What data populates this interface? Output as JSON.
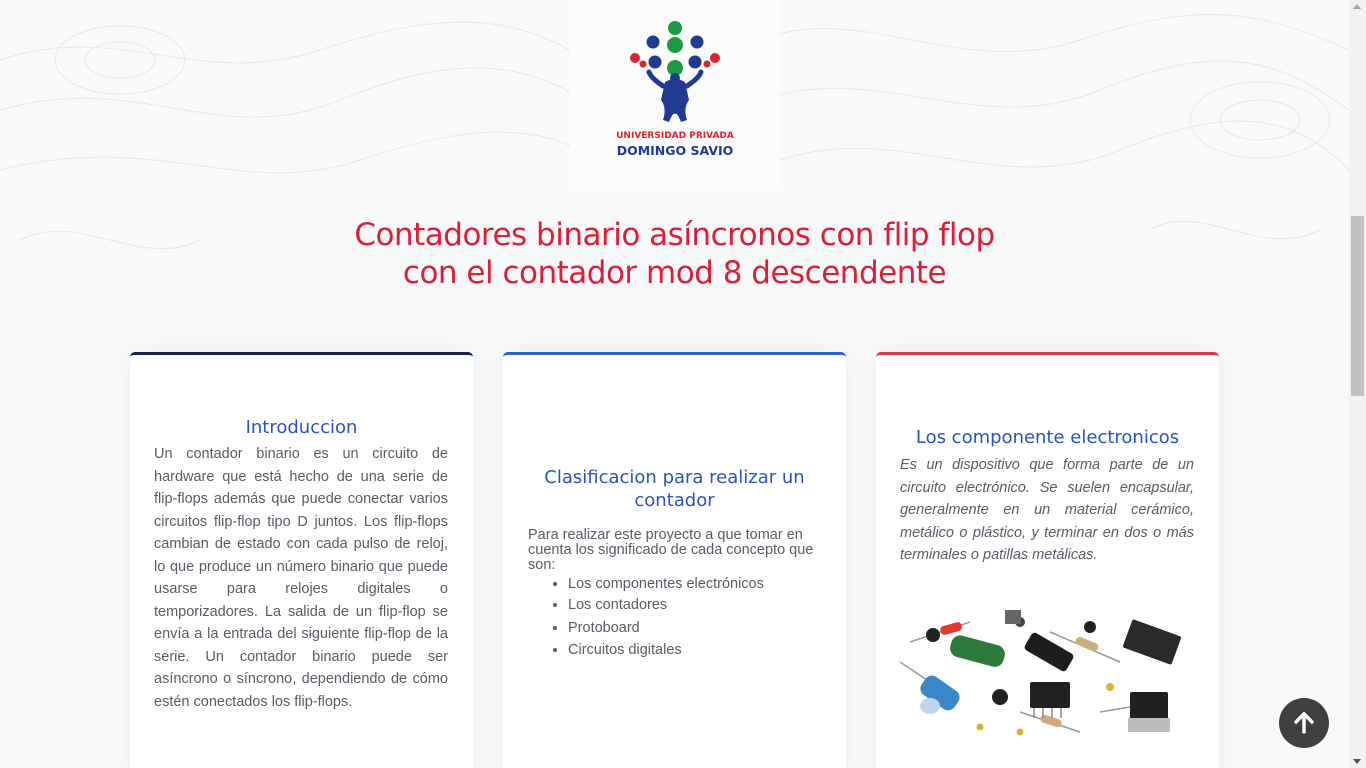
{
  "logo": {
    "line1": "UNIVERSIDAD PRIVADA",
    "line2": "DOMINGO SAVIO"
  },
  "page_title": {
    "line1": "Contadores binario asíncronos con flip flop",
    "line2": "con el contador mod 8 descendente"
  },
  "cards": [
    {
      "title": "Introduccion",
      "text": "Un contador binario es un circuito de hardware que está hecho de una serie de flip-flops además que puede conectar varios circuitos flip-flop tipo D juntos. Los flip-flops cambian de estado con cada pulso de reloj, lo que produce un número binario que puede usarse para relojes digitales o temporizadores. La salida de un flip-flop se envía a la entrada del siguiente flip-flop de la serie. Un contador binario puede ser asíncrono o síncrono, dependiendo de cómo estén conectados los flip-flops."
    },
    {
      "title": "Clasificacion para realizar un contador",
      "intro": "Para realizar este proyecto a que tomar en cuenta los significado de cada concepto que son:",
      "items": [
        "Los componentes electrónicos",
        "Los contadores",
        "Protoboard",
        "Circuitos digitales"
      ]
    },
    {
      "title": "Los componente electronicos",
      "text": "Es un dispositivo que forma parte de un circuito electrónico. Se suelen encapsular, generalmente en un material cerámico, metálico o plástico, y terminar en dos o más terminales o patillas metálicas."
    }
  ],
  "colors": {
    "title": "#dc1f35",
    "card_title": "#2b52c0",
    "card1_accent": "#1c2746",
    "card2_accent": "#2f5fd1",
    "card3_accent": "#dc3545",
    "back_to_top": "#3f3f3f"
  },
  "icons": {
    "back_to_top": "arrow-up-icon"
  }
}
